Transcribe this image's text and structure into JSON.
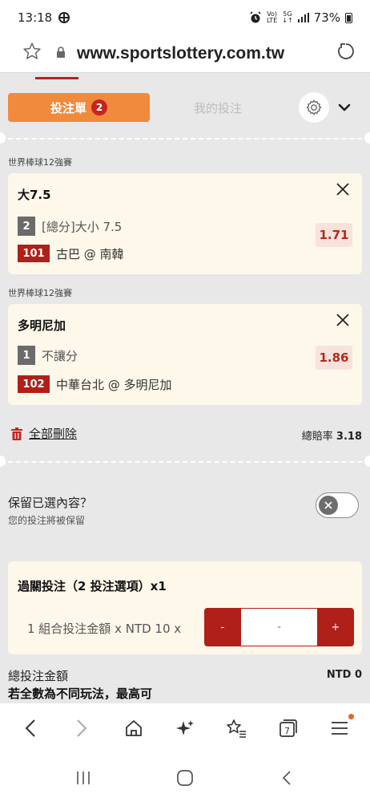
{
  "status": {
    "time": "13:18",
    "net_top": "Vo)",
    "net_bottom": "LTE",
    "net5g_top": "5G",
    "net5g_bottom": "↓↑",
    "battery": "73%"
  },
  "browser": {
    "url": "www.sportslottery.com.tw"
  },
  "tabs": {
    "betslip_label": "投注單",
    "betslip_count": "2",
    "mybets_label": "我的投注"
  },
  "bets": [
    {
      "league": "世界棒球12強賽",
      "title": "大7.5",
      "option_no": "2",
      "option_text": "[總分]大小 7.5",
      "match_no": "101",
      "match_text": "古巴 @ 南韓",
      "odds": "1.71"
    },
    {
      "league": "世界棒球12強賽",
      "title": "多明尼加",
      "option_no": "1",
      "option_text": "不讓分",
      "match_no": "102",
      "match_text": "中華台北 @ 多明尼加",
      "odds": "1.86"
    }
  ],
  "summary": {
    "delete_all": "全部刪除",
    "total_odds_label": "總賠率",
    "total_odds_value": "3.18"
  },
  "keep": {
    "title": "保留已選內容？",
    "subtitle": "您的投注將被保留"
  },
  "parlay": {
    "title": "過關投注（2 投注選項）x1",
    "desc": "1 組合投注金額 x NTD 10 x",
    "minus": "-",
    "amount": "-",
    "plus": "+"
  },
  "total": {
    "label": "總投注金額",
    "value": "NTD 0",
    "note": "若全數為不同玩法，最高可"
  },
  "colors": {
    "accent_orange": "#f08a3c",
    "brand_red": "#b02018",
    "card_bg": "#fdf8ea",
    "page_bg": "#e8e8e8"
  }
}
